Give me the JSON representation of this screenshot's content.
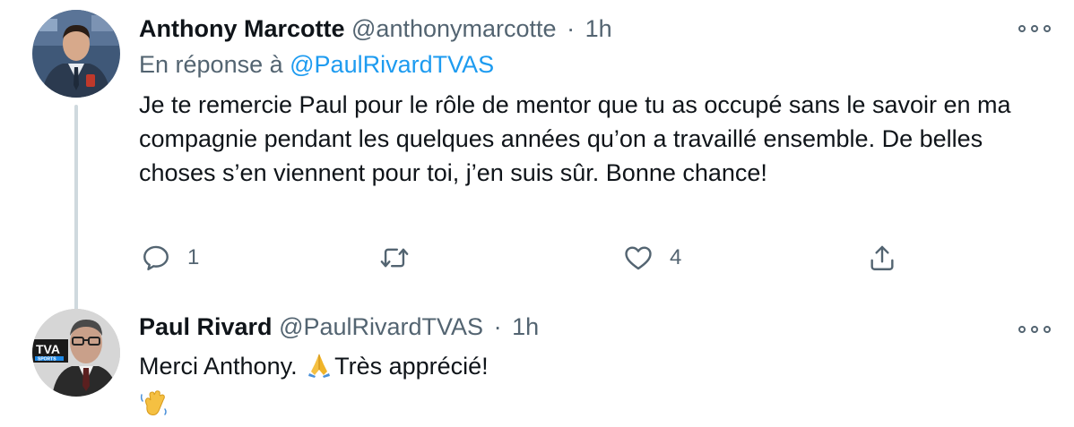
{
  "tweets": [
    {
      "author_name": "Anthony Marcotte",
      "handle": "@anthonymarcotte",
      "separator": "·",
      "time": "1h",
      "reply_prefix": "En réponse à",
      "reply_to": "@PaulRivardTVAS",
      "text": "Je te remercie Paul pour le rôle de mentor que tu as occupé sans le savoir en ma compagnie pendant les quelques années qu’on a travaillé ensemble. De belles choses s’en viennent pour toi, j’en suis sûr. Bonne chance!",
      "actions": {
        "reply_icon": "reply-icon",
        "reply_count": "1",
        "retweet_icon": "retweet-icon",
        "like_icon": "heart-icon",
        "like_count": "4",
        "share_icon": "share-icon"
      }
    },
    {
      "author_name": "Paul Rivard",
      "handle": "@PaulRivardTVAS",
      "separator": "·",
      "time": "1h",
      "text": "Merci Anthony.",
      "text_after_emoji": "Très apprécié!",
      "avatar_logo_text": "TVA",
      "avatar_logo_subtext": "SPORTS",
      "emojis": [
        "folded-hands-emoji",
        "waving-hand-emoji"
      ]
    }
  ],
  "colors": {
    "link": "#1d9bf0",
    "secondary_text": "#536471",
    "thread_line": "#cfd9de"
  }
}
